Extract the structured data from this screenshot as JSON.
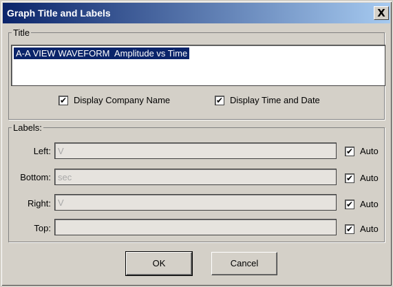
{
  "window": {
    "title": "Graph Title and Labels",
    "close_label": "X"
  },
  "title_group": {
    "legend": "Title",
    "value": "A-A VIEW WAVEFORM  Amplitude vs Time",
    "display_company_name": {
      "label": "Display Company Name",
      "checked": true
    },
    "display_time_date": {
      "label": "Display Time and Date",
      "checked": true
    }
  },
  "labels_group": {
    "legend": "Labels:",
    "rows": [
      {
        "label": "Left:",
        "value": "V",
        "auto_label": "Auto",
        "auto_checked": true
      },
      {
        "label": "Bottom:",
        "value": "sec",
        "auto_label": "Auto",
        "auto_checked": true
      },
      {
        "label": "Right:",
        "value": "V",
        "auto_label": "Auto",
        "auto_checked": true
      },
      {
        "label": "Top:",
        "value": "",
        "auto_label": "Auto",
        "auto_checked": true
      }
    ]
  },
  "buttons": {
    "ok": "OK",
    "cancel": "Cancel"
  },
  "check_glyph": "✔"
}
